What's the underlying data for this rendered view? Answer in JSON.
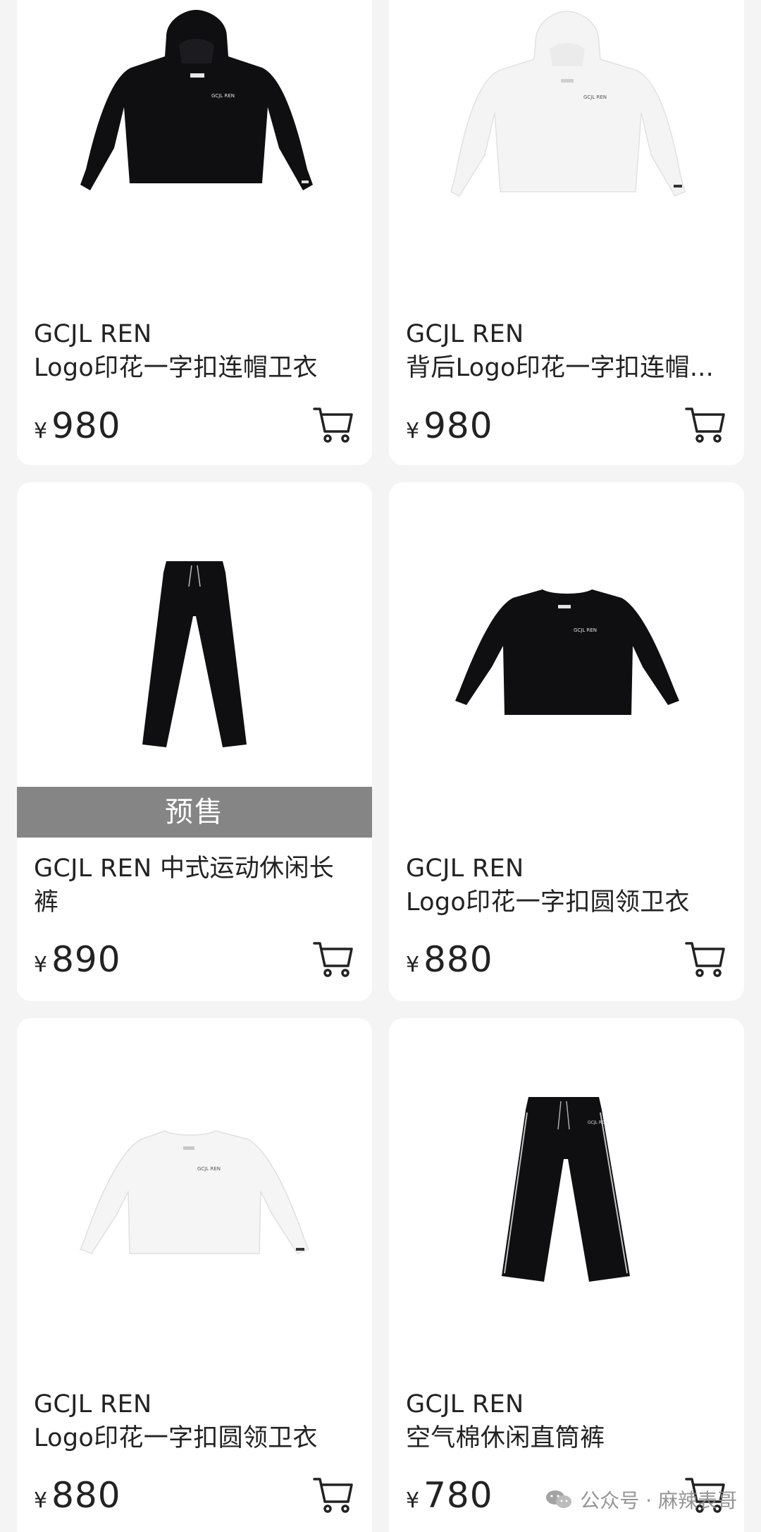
{
  "currency_symbol": "¥",
  "presale_label": "预售",
  "products": [
    {
      "brand": "GCJL REN",
      "name": "Logo印花一字扣连帽卫衣",
      "price": "980"
    },
    {
      "brand": "GCJL REN",
      "name": "背后Logo印花一字扣连帽...",
      "price": "980"
    },
    {
      "brand": "GCJL REN 中式运动休闲长",
      "name": "裤",
      "price": "890"
    },
    {
      "brand": "GCJL REN",
      "name": "Logo印花一字扣圆领卫衣",
      "price": "880"
    },
    {
      "brand": "GCJL REN",
      "name": "Logo印花一字扣圆领卫衣",
      "price": "880"
    },
    {
      "brand": "GCJL REN",
      "name": "空气棉休闲直筒裤",
      "price": "780"
    }
  ],
  "garment_print": "GCJL REN",
  "watermark": {
    "text": "公众号 · 麻辣表哥",
    "icon": "wechat-icon"
  },
  "colors": {
    "background": "#f4f4f4",
    "card": "#ffffff",
    "presale_banner": "#858585",
    "text": "#222222"
  }
}
